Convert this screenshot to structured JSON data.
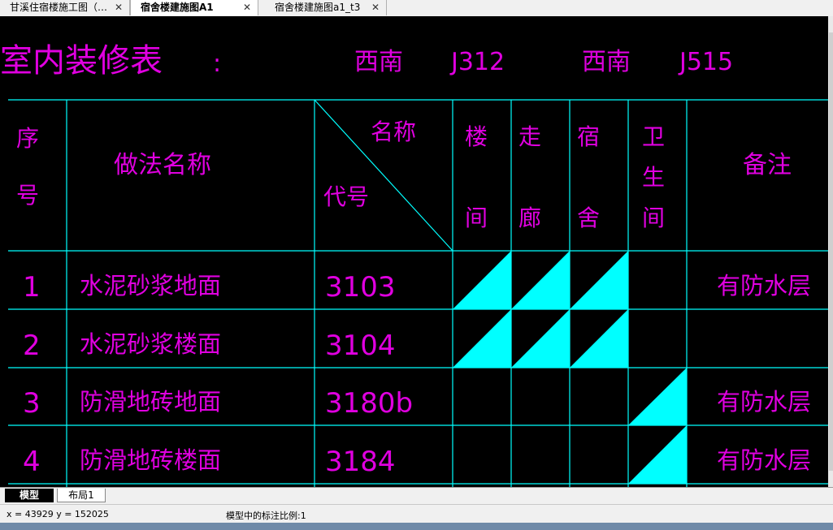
{
  "tabs": [
    {
      "label": "甘溪住宿楼施工图（…",
      "close": "✕"
    },
    {
      "label": "宿舍楼建施图A1",
      "close": "✕"
    },
    {
      "label": "宿舍楼建施图a1_t3",
      "close": "✕"
    }
  ],
  "drawing": {
    "title": "室内装修表",
    "colon": ":",
    "ref1_place": "西南",
    "ref1_code": "J312",
    "ref2_place": "西南",
    "ref2_code": "J515",
    "headers": {
      "seq": [
        "序",
        "号"
      ],
      "method": "做法名称",
      "diag_top": "名称",
      "diag_bottom": "代号",
      "stair": [
        "楼",
        "间"
      ],
      "corridor": [
        "走",
        "廊"
      ],
      "dorm": [
        "宿",
        "舍"
      ],
      "bath": [
        "卫",
        "生",
        "间"
      ],
      "note": "备注"
    },
    "rows": [
      {
        "seq": "1",
        "name": "水泥砂浆地面",
        "code": "3103",
        "note": "有防水层"
      },
      {
        "seq": "2",
        "name": "水泥砂浆楼面",
        "code": "3104",
        "note": ""
      },
      {
        "seq": "3",
        "name": "防滑地砖地面",
        "code": "3180b",
        "note": "有防水层"
      },
      {
        "seq": "4",
        "name": "防滑地砖楼面",
        "code": "3184",
        "note": "有防水层"
      }
    ]
  },
  "layout_tabs": [
    "模型",
    "布局1"
  ],
  "status": {
    "coords": "x = 43929  y = 152025",
    "annotation_scale": "模型中的标注比例:1"
  },
  "colors": {
    "line": "#00ffff",
    "text": "#e000e0",
    "background": "#000000"
  }
}
